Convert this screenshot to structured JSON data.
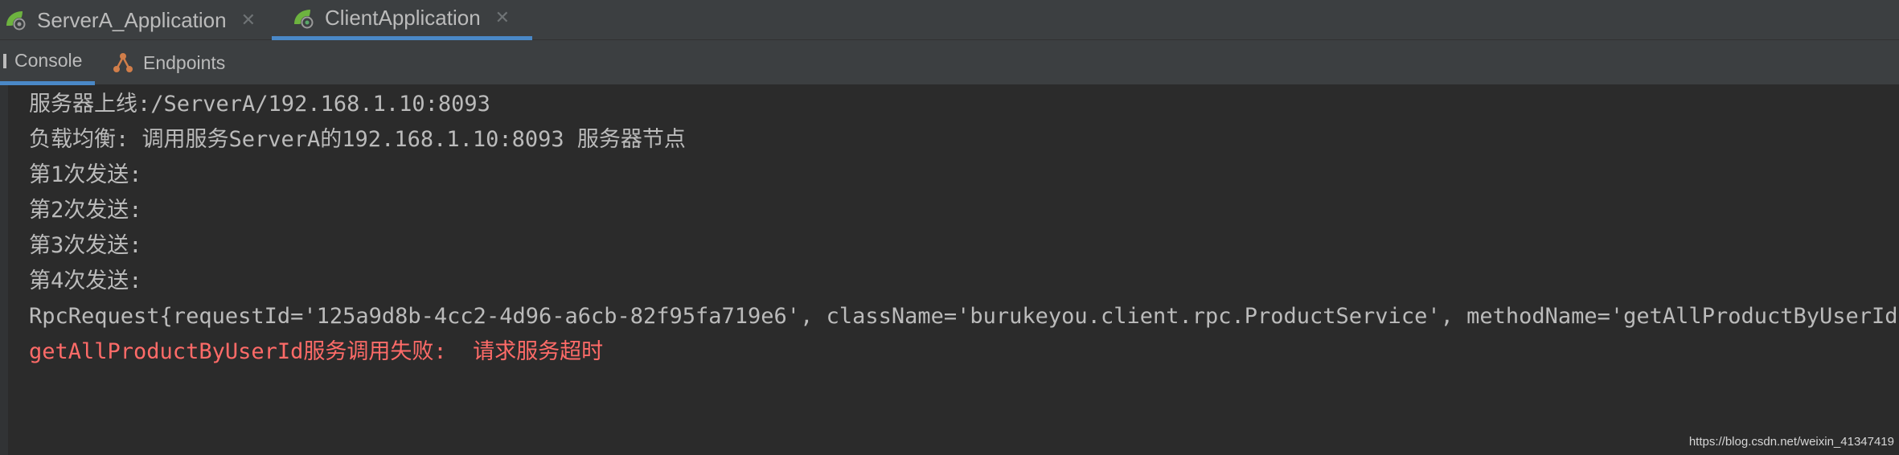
{
  "run_tabs": [
    {
      "label": "ServerA_Application",
      "icon": "spring-boot-run-icon",
      "active": false
    },
    {
      "label": "ClientApplication",
      "icon": "spring-boot-run-icon",
      "active": true
    }
  ],
  "tool_tabs": {
    "console": {
      "label": "Console",
      "active": true
    },
    "endpoints": {
      "label": "Endpoints",
      "icon": "endpoints-icon"
    }
  },
  "console": {
    "lines": [
      {
        "text": "服务器上线:/ServerA/192.168.1.10:8093",
        "type": "stdout"
      },
      {
        "text": "负载均衡: 调用服务ServerA的192.168.1.10:8093 服务器节点",
        "type": "stdout"
      },
      {
        "text": "第1次发送:",
        "type": "stdout"
      },
      {
        "text": "第2次发送:",
        "type": "stdout"
      },
      {
        "text": "第3次发送:",
        "type": "stdout"
      },
      {
        "text": "第4次发送:",
        "type": "stdout"
      },
      {
        "text": "RpcRequest{requestId='125a9d8b-4cc2-4d96-a6cb-82f95fa719e6', className='burukeyou.client.rpc.ProductService', methodName='getAllProductByUserId', ",
        "type": "stdout"
      },
      {
        "text": "getAllProductByUserId服务调用失败:  请求服务超时",
        "type": "stderr"
      }
    ]
  },
  "watermark": "https://blog.csdn.net/weixin_41347419",
  "colors": {
    "background": "#2b2b2b",
    "tab_bar": "#3c3f41",
    "text": "#bbbbbb",
    "error_text": "#ff6b68",
    "active_underline": "#4a88c7"
  }
}
